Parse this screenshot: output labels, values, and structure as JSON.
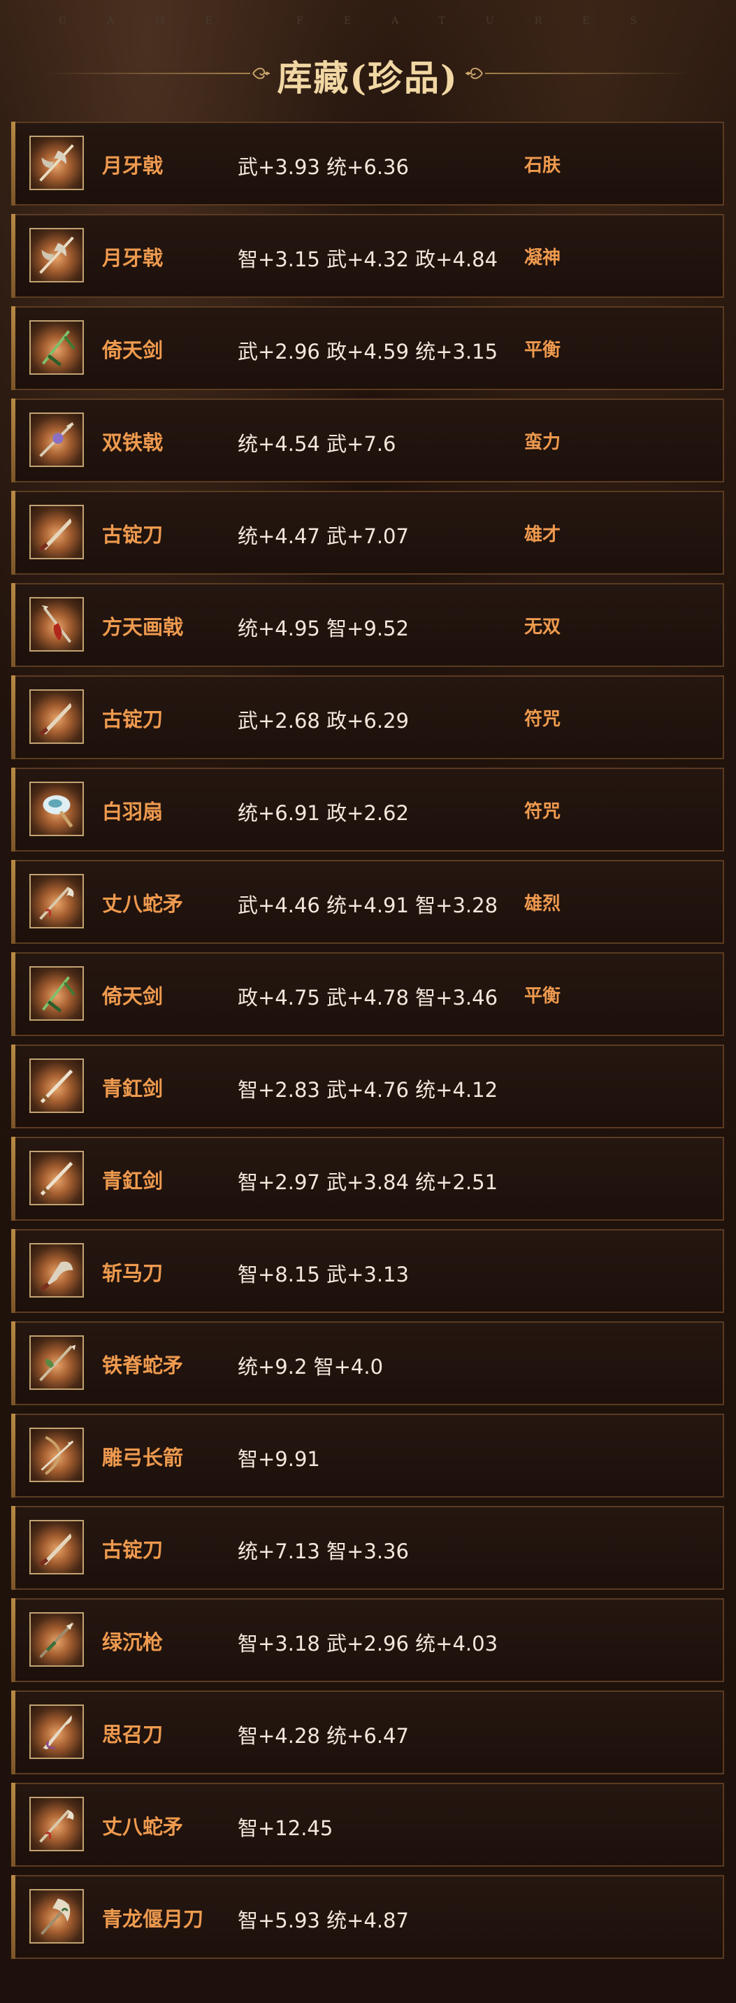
{
  "header": {
    "decor_text": "GAME FEATURES",
    "title": "库藏(珍品)"
  },
  "items": [
    {
      "name": "月牙戟",
      "stats": "武+3.93 统+6.36",
      "trait": "石肤",
      "icon": "crescent-halberd-icon"
    },
    {
      "name": "月牙戟",
      "stats": "智+3.15 武+4.32 政+4.84",
      "trait": "凝神",
      "icon": "crescent-halberd-icon"
    },
    {
      "name": "倚天剑",
      "stats": "武+2.96 政+4.59 统+3.15",
      "trait": "平衡",
      "icon": "green-sword-icon"
    },
    {
      "name": "双铁戟",
      "stats": "统+4.54 武+7.6",
      "trait": "蛮力",
      "icon": "double-halberd-icon"
    },
    {
      "name": "古锭刀",
      "stats": "统+4.47 武+7.07",
      "trait": "雄才",
      "icon": "saber-icon"
    },
    {
      "name": "方天画戟",
      "stats": "统+4.95 智+9.52",
      "trait": "无双",
      "icon": "painted-halberd-icon"
    },
    {
      "name": "古锭刀",
      "stats": "武+2.68 政+6.29",
      "trait": "符咒",
      "icon": "saber-icon"
    },
    {
      "name": "白羽扇",
      "stats": "统+6.91 政+2.62",
      "trait": "符咒",
      "icon": "feather-fan-icon"
    },
    {
      "name": "丈八蛇矛",
      "stats": "武+4.46 统+4.91 智+3.28",
      "trait": "雄烈",
      "icon": "serpent-spear-icon"
    },
    {
      "name": "倚天剑",
      "stats": "政+4.75 武+4.78 智+3.46",
      "trait": "平衡",
      "icon": "green-sword-icon"
    },
    {
      "name": "青釭剑",
      "stats": "智+2.83 武+4.76 统+4.12",
      "trait": "",
      "icon": "straight-sword-icon"
    },
    {
      "name": "青釭剑",
      "stats": "智+2.97 武+3.84 统+2.51",
      "trait": "",
      "icon": "straight-sword-icon"
    },
    {
      "name": "斩马刀",
      "stats": "智+8.15 武+3.13",
      "trait": "",
      "icon": "horse-blade-icon"
    },
    {
      "name": "铁脊蛇矛",
      "stats": "统+9.2 智+4.0",
      "trait": "",
      "icon": "iron-spear-icon"
    },
    {
      "name": "雕弓长箭",
      "stats": "智+9.91",
      "trait": "",
      "icon": "bow-arrow-icon"
    },
    {
      "name": "古锭刀",
      "stats": "统+7.13 智+3.36",
      "trait": "",
      "icon": "saber-icon"
    },
    {
      "name": "绿沉枪",
      "stats": "智+3.18 武+2.96 统+4.03",
      "trait": "",
      "icon": "green-spear-icon"
    },
    {
      "name": "思召刀",
      "stats": "智+4.28 统+6.47",
      "trait": "",
      "icon": "long-blade-icon"
    },
    {
      "name": "丈八蛇矛",
      "stats": "智+12.45",
      "trait": "",
      "icon": "serpent-spear-icon"
    },
    {
      "name": "青龙偃月刀",
      "stats": "智+5.93 统+4.87",
      "trait": "",
      "icon": "dragon-glaive-icon"
    }
  ]
}
